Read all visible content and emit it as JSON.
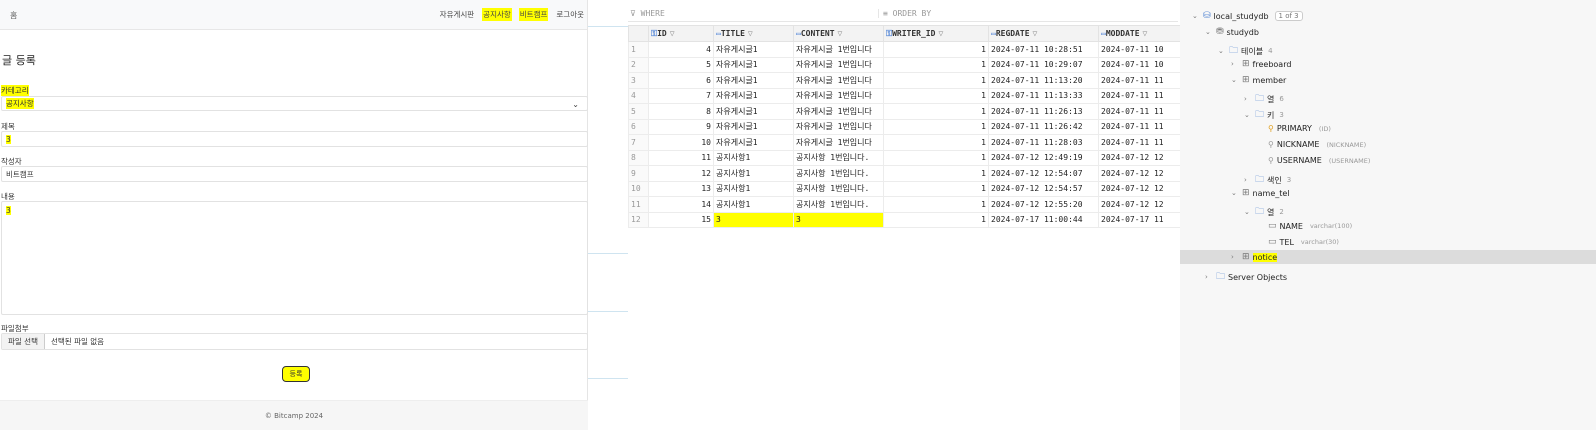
{
  "web": {
    "brand": "홈",
    "nav_links": [
      "자유게시판",
      "공지사항",
      "비트캠프",
      "로그아웃"
    ],
    "page_title": "글 등록",
    "category_label": "카테고리",
    "category_value": "공지사항",
    "title_label": "제목",
    "title_value": "3",
    "writer_label": "작성자",
    "writer_value": "비트캠프",
    "content_label": "내용",
    "content_value": "3",
    "file_label": "파일첨부",
    "file_button": "파일 선택",
    "file_none": "선택된 파일 없음",
    "submit": "등록",
    "footer": "© Bitcamp 2024"
  },
  "grid": {
    "where": "WHERE",
    "order_by": "ORDER BY",
    "columns": [
      "ID",
      "TITLE",
      "CONTENT",
      "WRITER_ID",
      "REGDATE",
      "MODDATE"
    ],
    "rows": [
      [
        "1",
        "4",
        "자유게시글1",
        "자유게시글 1번입니다",
        "1",
        "2024-07-11 10:28:51",
        "2024-07-11 10"
      ],
      [
        "2",
        "5",
        "자유게시글1",
        "자유게시글 1번입니다",
        "1",
        "2024-07-11 10:29:07",
        "2024-07-11 10"
      ],
      [
        "3",
        "6",
        "자유게시글1",
        "자유게시글 1번입니다",
        "1",
        "2024-07-11 11:13:20",
        "2024-07-11 11"
      ],
      [
        "4",
        "7",
        "자유게시글1",
        "자유게시글 1번입니다",
        "1",
        "2024-07-11 11:13:33",
        "2024-07-11 11"
      ],
      [
        "5",
        "8",
        "자유게시글1",
        "자유게시글 1번입니다",
        "1",
        "2024-07-11 11:26:13",
        "2024-07-11 11"
      ],
      [
        "6",
        "9",
        "자유게시글1",
        "자유게시글 1번입니다",
        "1",
        "2024-07-11 11:26:42",
        "2024-07-11 11"
      ],
      [
        "7",
        "10",
        "자유게시글1",
        "자유게시글 1번입니다",
        "1",
        "2024-07-11 11:28:03",
        "2024-07-11 11"
      ],
      [
        "8",
        "11",
        "공지사항1",
        "공지사항 1번입니다.",
        "1",
        "2024-07-12 12:49:19",
        "2024-07-12 12"
      ],
      [
        "9",
        "12",
        "공지사항1",
        "공지사항 1번입니다.",
        "1",
        "2024-07-12 12:54:07",
        "2024-07-12 12"
      ],
      [
        "10",
        "13",
        "공지사항1",
        "공지사항 1번입니다.",
        "1",
        "2024-07-12 12:54:57",
        "2024-07-12 12"
      ],
      [
        "11",
        "14",
        "공지사항1",
        "공지사항 1번입니다.",
        "1",
        "2024-07-12 12:55:20",
        "2024-07-12 12"
      ],
      [
        "12",
        "15",
        "3",
        "3",
        "1",
        "2024-07-17 11:00:44",
        "2024-07-17 11"
      ]
    ]
  },
  "tree": {
    "conn": "local_studydb",
    "conn_badge": "1 of 3",
    "db": "studydb",
    "tables_folder": "테이블",
    "tables_count": "4",
    "freeboard": "freeboard",
    "member": "member",
    "cols_folder": "열",
    "cols_count": "6",
    "keys_folder": "키",
    "keys_count": "3",
    "key1": "PRIMARY",
    "key1_sub": "(ID)",
    "key2": "NICKNAME",
    "key2_sub": "(NICKNAME)",
    "key3": "USERNAME",
    "key3_sub": "(USERNAME)",
    "idx_folder": "색인",
    "idx_count": "3",
    "name_tel": "name_tel",
    "nt_cols": "열",
    "nt_cols_count": "2",
    "col1": "NAME",
    "col1_sub": "varchar(100)",
    "col2": "TEL",
    "col2_sub": "varchar(30)",
    "notice": "notice",
    "server_objects": "Server Objects"
  }
}
